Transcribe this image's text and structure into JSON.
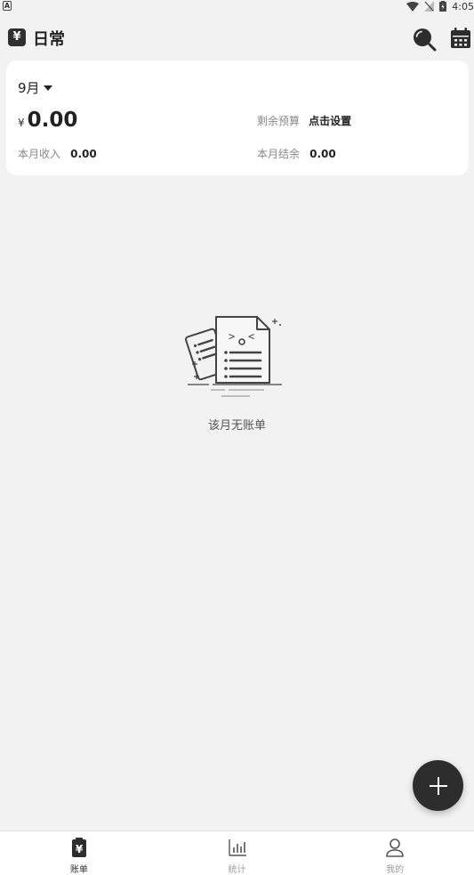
{
  "status_bar": {
    "time": "4:05"
  },
  "header": {
    "title": "日常"
  },
  "card": {
    "month": "9月",
    "currency": "¥",
    "expense": "0.00",
    "budget_label": "剩余预算",
    "budget_action": "点击设置",
    "income_label": "本月收入",
    "income_value": "0.00",
    "balance_label": "本月结余",
    "balance_value": "0.00"
  },
  "empty": {
    "message": "该月无账单"
  },
  "nav": {
    "items": [
      {
        "label": "账单",
        "icon": "bill-icon",
        "active": true
      },
      {
        "label": "统计",
        "icon": "chart-icon",
        "active": false
      },
      {
        "label": "我的",
        "icon": "user-icon",
        "active": false
      }
    ]
  },
  "colors": {
    "accent": "#2d2d2d",
    "background": "#f2f2f2",
    "card": "#ffffff",
    "muted": "#888888"
  }
}
